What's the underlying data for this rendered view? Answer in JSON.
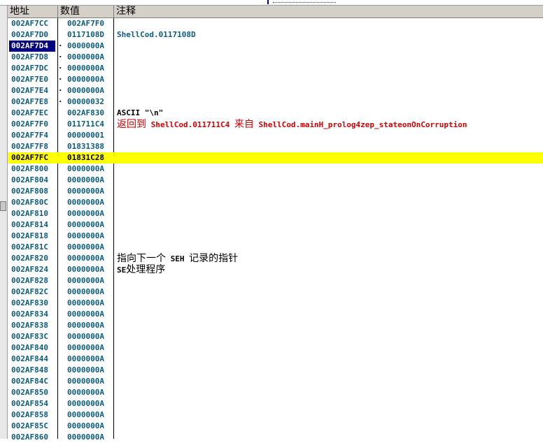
{
  "header": {
    "address": "地址",
    "value": "数值",
    "comment": "注释"
  },
  "colors": {
    "highlight": "#ffff00",
    "selection": "#000080",
    "text": "#0e5b80",
    "red_comment": "#d40000"
  },
  "rows": [
    {
      "addr": "002AF7CC",
      "mark": "",
      "val": "002AF7F0",
      "parts": []
    },
    {
      "addr": "002AF7D0",
      "mark": "",
      "val": "0117108D",
      "parts": [
        {
          "t": "ShellCod.0117108D",
          "zh": false
        }
      ]
    },
    {
      "addr": "002AF7D4",
      "mark": "·",
      "val": "0000000A",
      "parts": [],
      "sel": true
    },
    {
      "addr": "002AF7D8",
      "mark": "·",
      "val": "0000000A",
      "parts": []
    },
    {
      "addr": "002AF7DC",
      "mark": "·",
      "val": "0000000A",
      "parts": []
    },
    {
      "addr": "002AF7E0",
      "mark": "·",
      "val": "0000000A",
      "parts": []
    },
    {
      "addr": "002AF7E4",
      "mark": "·",
      "val": "0000000A",
      "parts": []
    },
    {
      "addr": "002AF7E8",
      "mark": "·",
      "val": "00000032",
      "parts": []
    },
    {
      "addr": "002AF7EC",
      "mark": "",
      "val": "002AF830",
      "parts": [
        {
          "t": "ASCII \"\\n\"",
          "zh": false
        }
      ],
      "cmt_color": "black"
    },
    {
      "addr": "002AF7F0",
      "mark": "",
      "val": "011711C4",
      "parts": [
        {
          "t": "返回到",
          "zh": true
        },
        {
          "t": " ShellCod.011711C4 ",
          "zh": false
        },
        {
          "t": "来自",
          "zh": true
        },
        {
          "t": " ShellCod.mainH_prolog4zep_stateonOnCorruption",
          "zh": false
        }
      ],
      "cmt_color": "red"
    },
    {
      "addr": "002AF7F4",
      "mark": "",
      "val": "00000001",
      "parts": []
    },
    {
      "addr": "002AF7F8",
      "mark": "",
      "val": "01831388",
      "parts": []
    },
    {
      "addr": "002AF7FC",
      "mark": "",
      "val": "01831C28",
      "parts": [],
      "hl": true
    },
    {
      "addr": "002AF800",
      "mark": "",
      "val": "0000000A",
      "parts": []
    },
    {
      "addr": "002AF804",
      "mark": "",
      "val": "0000000A",
      "parts": []
    },
    {
      "addr": "002AF808",
      "mark": "",
      "val": "0000000A",
      "parts": []
    },
    {
      "addr": "002AF80C",
      "mark": "",
      "val": "0000000A",
      "parts": []
    },
    {
      "addr": "002AF810",
      "mark": "",
      "val": "0000000A",
      "parts": []
    },
    {
      "addr": "002AF814",
      "mark": "",
      "val": "0000000A",
      "parts": []
    },
    {
      "addr": "002AF818",
      "mark": "",
      "val": "0000000A",
      "parts": []
    },
    {
      "addr": "002AF81C",
      "mark": "",
      "val": "0000000A",
      "parts": []
    },
    {
      "addr": "002AF820",
      "mark": "",
      "val": "0000000A",
      "parts": [
        {
          "t": "指向下一个",
          "zh": true
        },
        {
          "t": " SEH ",
          "zh": false
        },
        {
          "t": "记录的指针",
          "zh": true
        }
      ],
      "cmt_color": "black"
    },
    {
      "addr": "002AF824",
      "mark": "",
      "val": "0000000A",
      "parts": [
        {
          "t": "SE",
          "zh": false
        },
        {
          "t": "处理程序",
          "zh": true
        }
      ],
      "cmt_color": "black"
    },
    {
      "addr": "002AF828",
      "mark": "",
      "val": "0000000A",
      "parts": []
    },
    {
      "addr": "002AF82C",
      "mark": "",
      "val": "0000000A",
      "parts": []
    },
    {
      "addr": "002AF830",
      "mark": "",
      "val": "0000000A",
      "parts": []
    },
    {
      "addr": "002AF834",
      "mark": "",
      "val": "0000000A",
      "parts": []
    },
    {
      "addr": "002AF838",
      "mark": "",
      "val": "0000000A",
      "parts": []
    },
    {
      "addr": "002AF83C",
      "mark": "",
      "val": "0000000A",
      "parts": []
    },
    {
      "addr": "002AF840",
      "mark": "",
      "val": "0000000A",
      "parts": []
    },
    {
      "addr": "002AF844",
      "mark": "",
      "val": "0000000A",
      "parts": []
    },
    {
      "addr": "002AF848",
      "mark": "",
      "val": "0000000A",
      "parts": []
    },
    {
      "addr": "002AF84C",
      "mark": "",
      "val": "0000000A",
      "parts": []
    },
    {
      "addr": "002AF850",
      "mark": "",
      "val": "0000000A",
      "parts": []
    },
    {
      "addr": "002AF854",
      "mark": "",
      "val": "0000000A",
      "parts": []
    },
    {
      "addr": "002AF858",
      "mark": "",
      "val": "0000000A",
      "parts": []
    },
    {
      "addr": "002AF85C",
      "mark": "",
      "val": "0000000A",
      "parts": []
    },
    {
      "addr": "002AF860",
      "mark": "",
      "val": "0000000A",
      "parts": []
    }
  ]
}
